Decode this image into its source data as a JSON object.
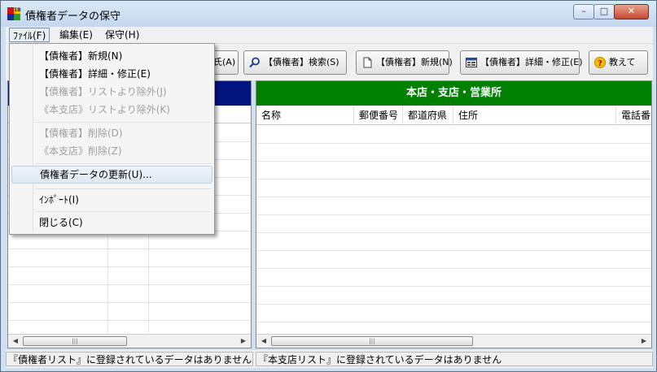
{
  "window": {
    "title": "債権者データの保守",
    "app_icon_text": "1B"
  },
  "menubar": {
    "file": "ﾌｧｲﾙ(F)",
    "edit": "編集(E)",
    "keep": "保守(H)"
  },
  "toolbar": {
    "hidden_btn_tail": "氏(A)",
    "search": "【債権者】検索(S)",
    "new": "【債権者】新規(N)",
    "detail": "【債権者】詳細・修正(E)",
    "help": "教えて"
  },
  "file_menu": {
    "items": [
      {
        "label": "【債権者】新規(N)",
        "enabled": true
      },
      {
        "label": "【債権者】詳細・修正(E)",
        "enabled": true
      },
      {
        "label": "【債権者】リストより除外(J)",
        "enabled": false
      },
      {
        "label": "《本支店》リストより除外(K)",
        "enabled": false
      },
      {
        "label": "【債権者】削除(D)",
        "enabled": false
      },
      {
        "label": "《本支店》削除(Z)",
        "enabled": false
      },
      {
        "label": "債権者データの更新(U)...",
        "enabled": true,
        "highlighted": true
      },
      {
        "label": "ｲﾝﾎﾟｰﾄ(I)",
        "enabled": true
      },
      {
        "label": "閉じる(C)",
        "enabled": true
      }
    ]
  },
  "right_pane": {
    "header": "本店・支店・営業所",
    "columns": [
      "名称",
      "郵便番号",
      "都道府県",
      "住所",
      "電話番"
    ]
  },
  "status": {
    "left": "『債権者リスト』に登録されているデータはありません",
    "right": "『本支店リスト』に登録されているデータはありません"
  },
  "colors": {
    "left_header": "#00137f",
    "right_header": "#008000"
  }
}
